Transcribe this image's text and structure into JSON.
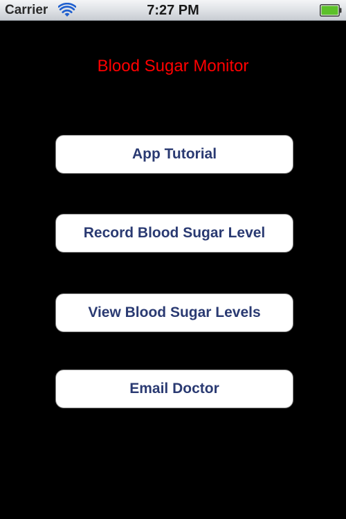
{
  "status_bar": {
    "carrier": "Carrier",
    "time": "7:27 PM",
    "wifi_icon": "wifi-icon",
    "battery_icon": "battery-icon",
    "battery_level": 1.0,
    "battery_color": "#5cc12a"
  },
  "app": {
    "title": "Blood Sugar Monitor",
    "title_color": "#ff0000",
    "background_color": "#000000"
  },
  "menu": {
    "button_text_color": "#2a3a72",
    "buttons": [
      {
        "label": "App Tutorial"
      },
      {
        "label": "Record Blood Sugar Level"
      },
      {
        "label": "View Blood Sugar Levels"
      },
      {
        "label": "Email Doctor"
      }
    ]
  }
}
